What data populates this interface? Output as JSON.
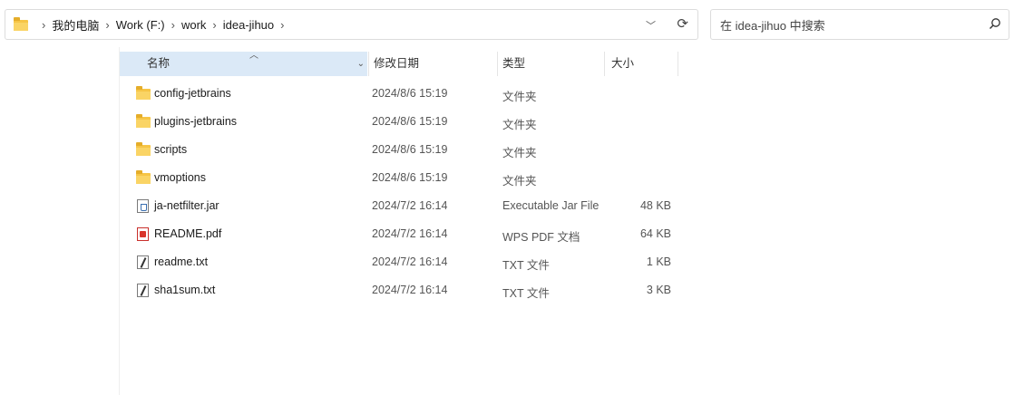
{
  "address_bar": {
    "crumbs": [
      "我的电脑",
      "Work (F:)",
      "work",
      "idea-jihuo"
    ]
  },
  "search": {
    "placeholder": "在 idea-jihuo 中搜索"
  },
  "columns": {
    "name": "名称",
    "date": "修改日期",
    "type": "类型",
    "size": "大小"
  },
  "files": [
    {
      "name": "config-jetbrains",
      "date": "2024/8/6 15:19",
      "type": "文件夹",
      "size": "",
      "icon": "folder-icon"
    },
    {
      "name": "plugins-jetbrains",
      "date": "2024/8/6 15:19",
      "type": "文件夹",
      "size": "",
      "icon": "folder-icon"
    },
    {
      "name": "scripts",
      "date": "2024/8/6 15:19",
      "type": "文件夹",
      "size": "",
      "icon": "folder-icon"
    },
    {
      "name": "vmoptions",
      "date": "2024/8/6 15:19",
      "type": "文件夹",
      "size": "",
      "icon": "folder-icon"
    },
    {
      "name": "ja-netfilter.jar",
      "date": "2024/7/2 16:14",
      "type": "Executable Jar File",
      "size": "48 KB",
      "icon": "jar-file-icon"
    },
    {
      "name": "README.pdf",
      "date": "2024/7/2 16:14",
      "type": "WPS PDF 文档",
      "size": "64 KB",
      "icon": "pdf-file-icon"
    },
    {
      "name": "readme.txt",
      "date": "2024/7/2 16:14",
      "type": "TXT 文件",
      "size": "1 KB",
      "icon": "txt-file-icon"
    },
    {
      "name": "sha1sum.txt",
      "date": "2024/7/2 16:14",
      "type": "TXT 文件",
      "size": "3 KB",
      "icon": "txt-file-icon"
    }
  ]
}
